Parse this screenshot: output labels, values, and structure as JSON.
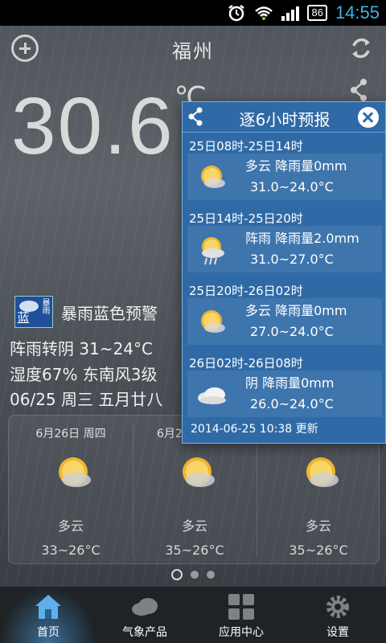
{
  "status_bar": {
    "battery": "86",
    "time": "14:55"
  },
  "header": {
    "city": "福州"
  },
  "current": {
    "temperature": "30.6",
    "unit_partial": "℃",
    "alert": "暴雨蓝色预警",
    "alert_icon_char": "蓝",
    "alert_icon_chars_small": "暴雨",
    "condition": "阵雨转阴  31~24°C",
    "humidity_wind": "湿度67%  东南风3级",
    "date_line": "06/25  周三  五月廿八"
  },
  "forecast": [
    {
      "date": "6月26日 周四",
      "condition": "多云",
      "range": "33~26°C",
      "icon": "cloudy-sun-icon"
    },
    {
      "date": "6月2",
      "condition": "多云",
      "range": "35~26°C",
      "icon": "cloudy-sun-icon"
    },
    {
      "date": "",
      "condition": "多云",
      "range": "35~26°C",
      "icon": "cloudy-sun-icon"
    }
  ],
  "popup": {
    "title": "逐6小时预报",
    "slots": [
      {
        "time": "25日08时-25日14时",
        "condition": "多云",
        "rain": "降雨量0mm",
        "range": "31.0~24.0°C",
        "icon": "cloudy-sun-icon"
      },
      {
        "time": "25日14时-25日20时",
        "condition": "阵雨",
        "rain": "降雨量2.0mm",
        "range": "31.0~27.0°C",
        "icon": "shower-icon"
      },
      {
        "time": "25日20时-26日02时",
        "condition": "多云",
        "rain": "降雨量0mm",
        "range": "27.0~24.0°C",
        "icon": "cloudy-sun-icon"
      },
      {
        "time": "26日02时-26日08时",
        "condition": "阴",
        "rain": "降雨量0mm",
        "range": "26.0~24.0°C",
        "icon": "overcast-icon"
      }
    ],
    "updated": "2014-06-25 10:38 更新"
  },
  "tabs": [
    {
      "label": "首页",
      "icon": "home-icon",
      "active": true
    },
    {
      "label": "气象产品",
      "icon": "cloud-icon"
    },
    {
      "label": "应用中心",
      "icon": "apps-grid-icon"
    },
    {
      "label": "设置",
      "icon": "gear-icon"
    }
  ],
  "colors": {
    "popup_bg": "#2f6aa6",
    "status_time": "#39b5e8",
    "tab_active": "#3a6e98"
  }
}
